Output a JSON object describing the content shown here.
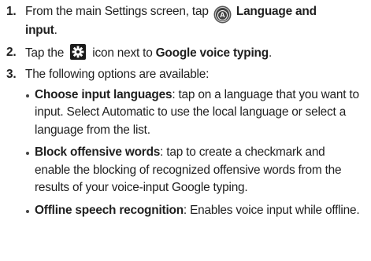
{
  "steps": [
    {
      "number": "1.",
      "pre": "From the main Settings screen, tap",
      "icon": "accessibility-a-icon",
      "icon_letter": "A",
      "bold_1": "Language and",
      "bold_2": "input",
      "post": "."
    },
    {
      "number": "2.",
      "pre": "Tap the",
      "icon": "gear-icon",
      "mid": "icon next to",
      "bold": "Google voice typing",
      "post": "."
    },
    {
      "number": "3.",
      "text": "The following options are available:",
      "bullets": [
        {
          "term": "Choose input languages",
          "desc_line1": ": tap on a language that you want to",
          "desc_line2": "input. Select Automatic to use the local language or select a",
          "desc_line3": "language from the list."
        },
        {
          "term": "Block offensive words",
          "desc_line1": ": tap to create a checkmark and",
          "desc_line2": "enable the blocking of recognized offensive words from the",
          "desc_line3": "results of your voice-input Google typing."
        },
        {
          "term": "Offline speech recognition",
          "desc_line1": ": Enables voice input while offline."
        }
      ]
    }
  ]
}
